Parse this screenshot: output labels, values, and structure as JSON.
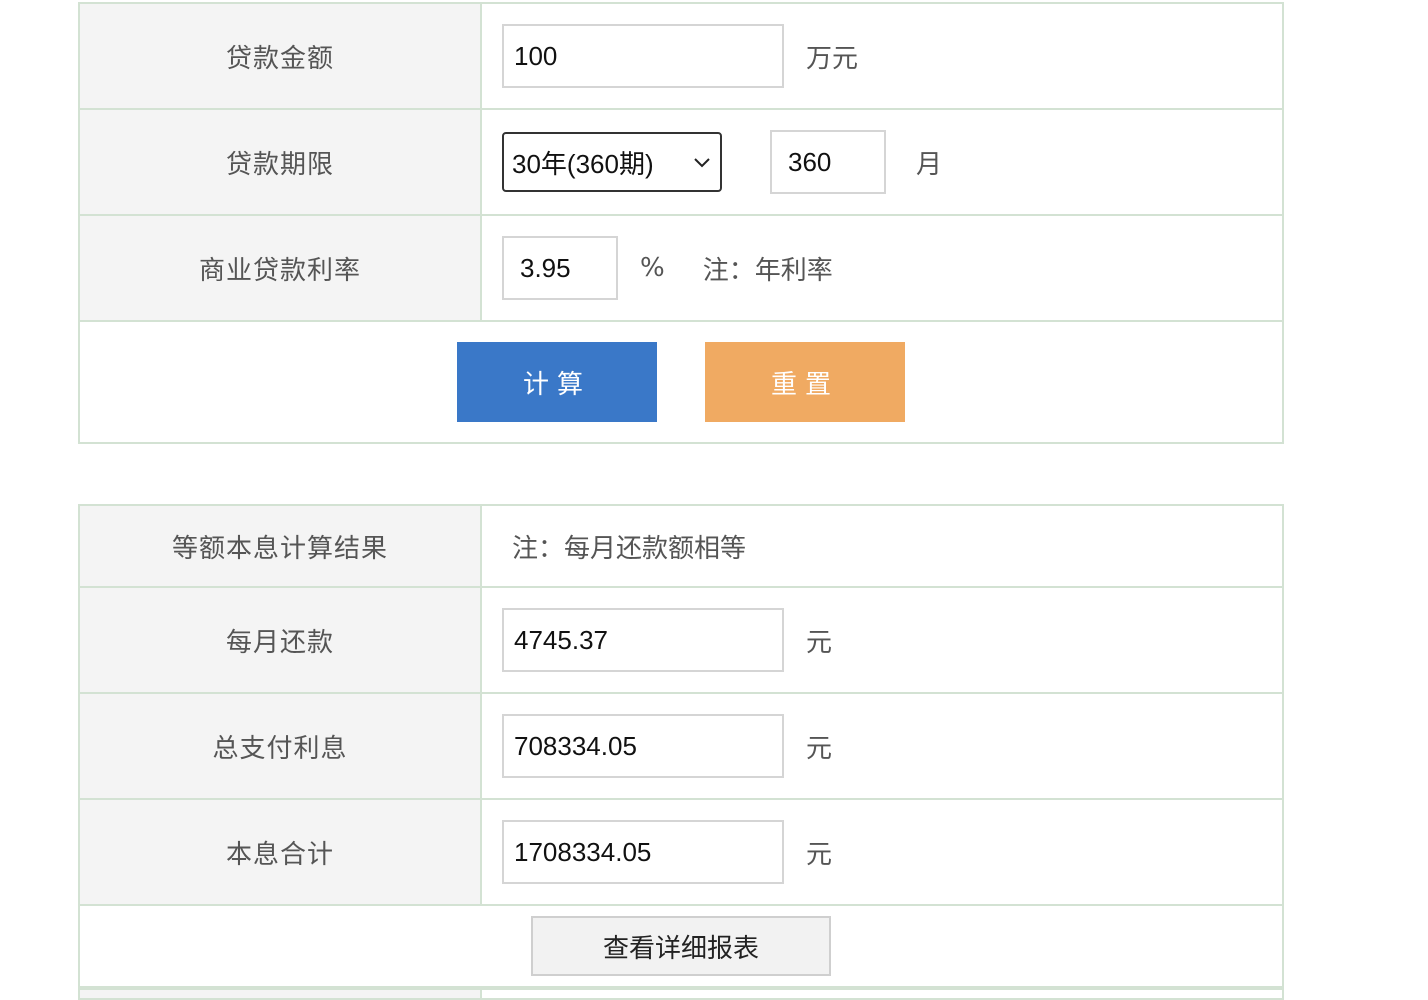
{
  "form": {
    "loan_amount": {
      "label": "贷款金额",
      "value": "100",
      "unit": "万元"
    },
    "loan_term": {
      "label": "贷款期限",
      "selected": "30年(360期)",
      "months_value": "360",
      "unit": "月"
    },
    "rate": {
      "label": "商业贷款利率",
      "value": "3.95",
      "unit": "%",
      "note": "注：年利率"
    },
    "calculate_label": "计算",
    "reset_label": "重置"
  },
  "result": {
    "title": "等额本息计算结果",
    "note": "注：每月还款额相等",
    "monthly": {
      "label": "每月还款",
      "value": "4745.37",
      "unit": "元"
    },
    "total_interest": {
      "label": "总支付利息",
      "value": "708334.05",
      "unit": "元"
    },
    "total": {
      "label": "本息合计",
      "value": "1708334.05",
      "unit": "元"
    },
    "report_label": "查看详细报表"
  },
  "colors": {
    "calculate_button": "#3a78c8",
    "reset_button": "#f0aa62",
    "border": "#d3e2d3",
    "label_bg": "#f4f4f4"
  }
}
